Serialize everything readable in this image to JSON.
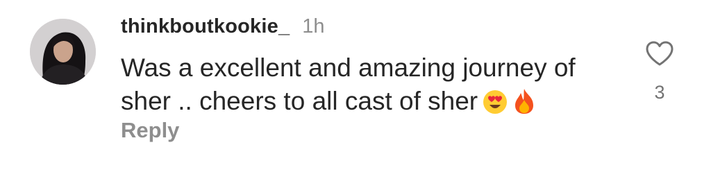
{
  "comment": {
    "username": "thinkboutkookie_",
    "time": "1h",
    "text_line1": "Was a excellent and amazing journey of",
    "text_line2": "sher .. cheers to all cast of sher",
    "emojis": [
      "heart-eyes-emoji",
      "fire-emoji"
    ],
    "reply_label": "Reply",
    "like_count": "3",
    "like_icon": "heart-outline-icon",
    "avatar_icon": "profile-photo"
  }
}
